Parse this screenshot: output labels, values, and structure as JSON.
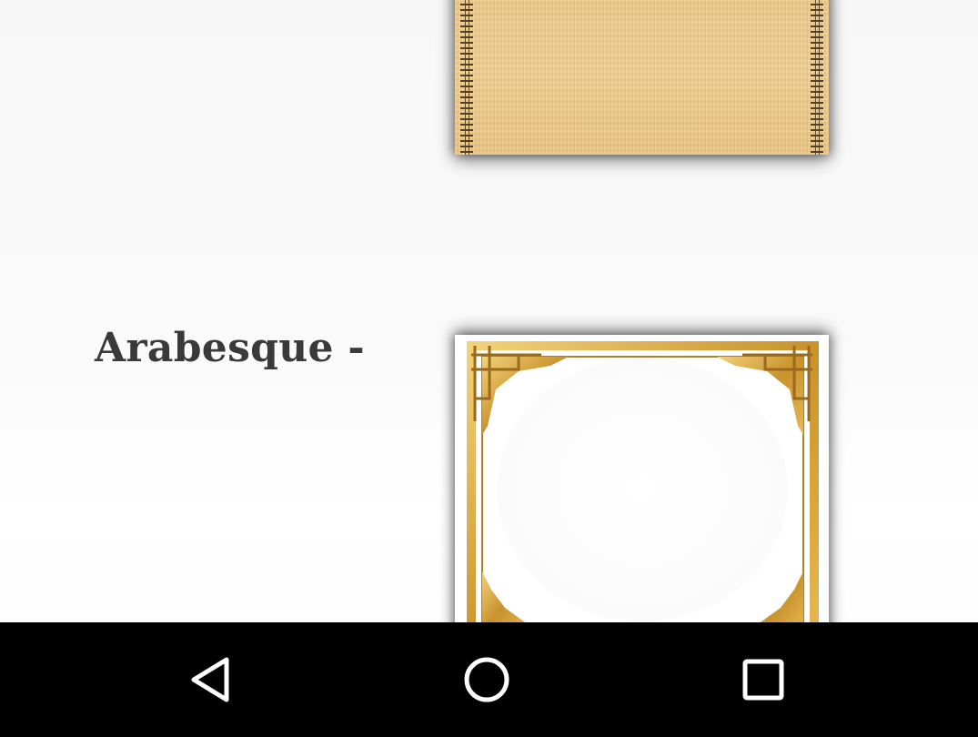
{
  "themes": {
    "items": [
      {
        "id": "parchment",
        "label": "",
        "accent": "#ecc889"
      },
      {
        "id": "arabesque",
        "label": "Arabesque -",
        "accent": "#d4a03a"
      }
    ]
  },
  "navigation": {
    "back_icon": "back-triangle-icon",
    "home_icon": "home-circle-icon",
    "recents_icon": "recents-square-icon",
    "background": "#000000",
    "icon_color": "#ffffff"
  }
}
